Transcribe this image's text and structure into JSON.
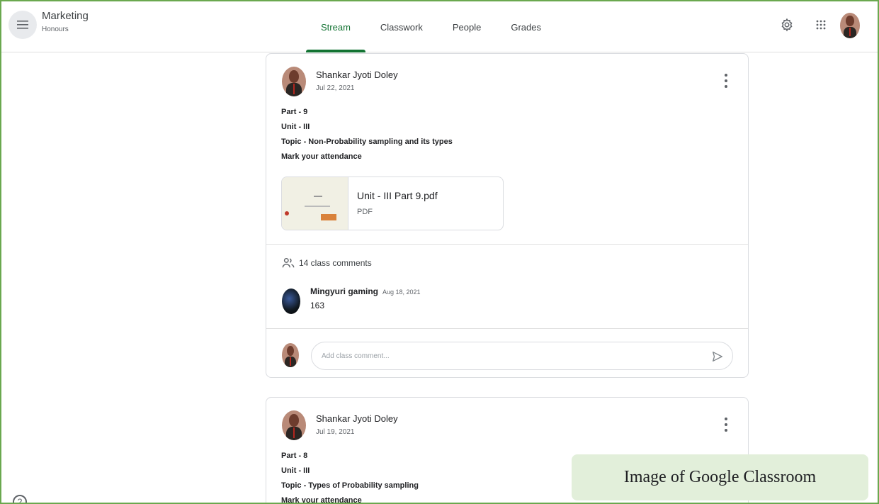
{
  "header": {
    "class_name": "Marketing",
    "class_section": "Honours",
    "tabs": [
      {
        "label": "Stream",
        "active": true
      },
      {
        "label": "Classwork",
        "active": false
      },
      {
        "label": "People",
        "active": false
      },
      {
        "label": "Grades",
        "active": false
      }
    ],
    "icons": [
      "menu-icon",
      "settings-icon",
      "apps-grid-icon",
      "account-avatar"
    ],
    "accent_color": "#137333"
  },
  "posts": [
    {
      "author": "Shankar Jyoti Doley",
      "date": "Jul 22, 2021",
      "lines": [
        "Part - 9",
        "Unit - III",
        "Topic - Non-Probability sampling and its types",
        "Mark your attendance"
      ],
      "attachment": {
        "title": "Unit - III Part 9.pdf",
        "type": "PDF"
      },
      "comments_count": "14 class comments",
      "latest_comment": {
        "author": "Mingyuri gaming",
        "date": "Aug 18, 2021",
        "text": "163"
      },
      "reply_placeholder": "Add class comment..."
    },
    {
      "author": "Shankar Jyoti Doley",
      "date": "Jul 19, 2021",
      "lines": [
        "Part - 8",
        "Unit - III",
        "Topic - Types of Probability sampling",
        "Mark your attendance"
      ]
    }
  ],
  "caption": "Image of Google Classroom",
  "help_label": "?"
}
